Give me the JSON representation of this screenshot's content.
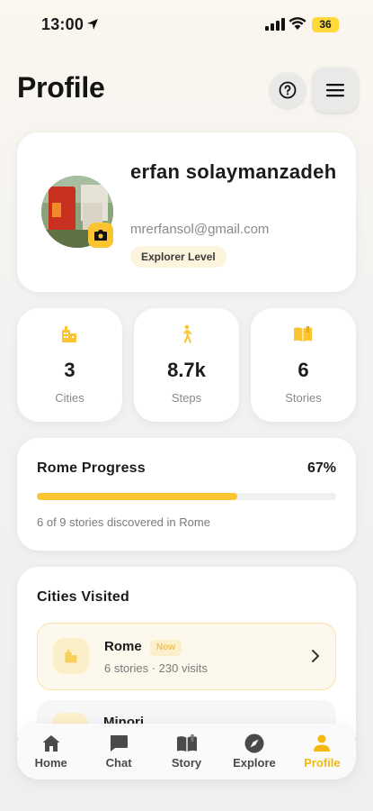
{
  "status_bar": {
    "time": "13:00",
    "battery": "36"
  },
  "header": {
    "title": "Profile"
  },
  "profile": {
    "name": "erfan solaymanzadeh",
    "email": "mrerfansol@gmail.com",
    "level": "Explorer Level"
  },
  "stats": [
    {
      "icon": "city-icon",
      "value": "3",
      "label": "Cities"
    },
    {
      "icon": "walking-icon",
      "value": "8.7k",
      "label": "Steps"
    },
    {
      "icon": "book-icon",
      "value": "6",
      "label": "Stories"
    }
  ],
  "progress": {
    "title": "Rome Progress",
    "percent_label": "67%",
    "percent": 0.67,
    "caption": "6 of 9 stories discovered in Rome"
  },
  "cities": {
    "title": "Cities Visited",
    "items": [
      {
        "name": "Rome",
        "badge": "Now",
        "subtitle": "6 stories · 230 visits"
      },
      {
        "name": "Minori"
      }
    ]
  },
  "tabs": [
    {
      "label": "Home",
      "icon": "home-icon"
    },
    {
      "label": "Chat",
      "icon": "chat-icon"
    },
    {
      "label": "Story",
      "icon": "story-icon"
    },
    {
      "label": "Explore",
      "icon": "compass-icon"
    },
    {
      "label": "Profile",
      "icon": "person-icon",
      "active": true
    }
  ],
  "colors": {
    "accent": "#fbc531",
    "accent_text": "#f5b80e"
  }
}
